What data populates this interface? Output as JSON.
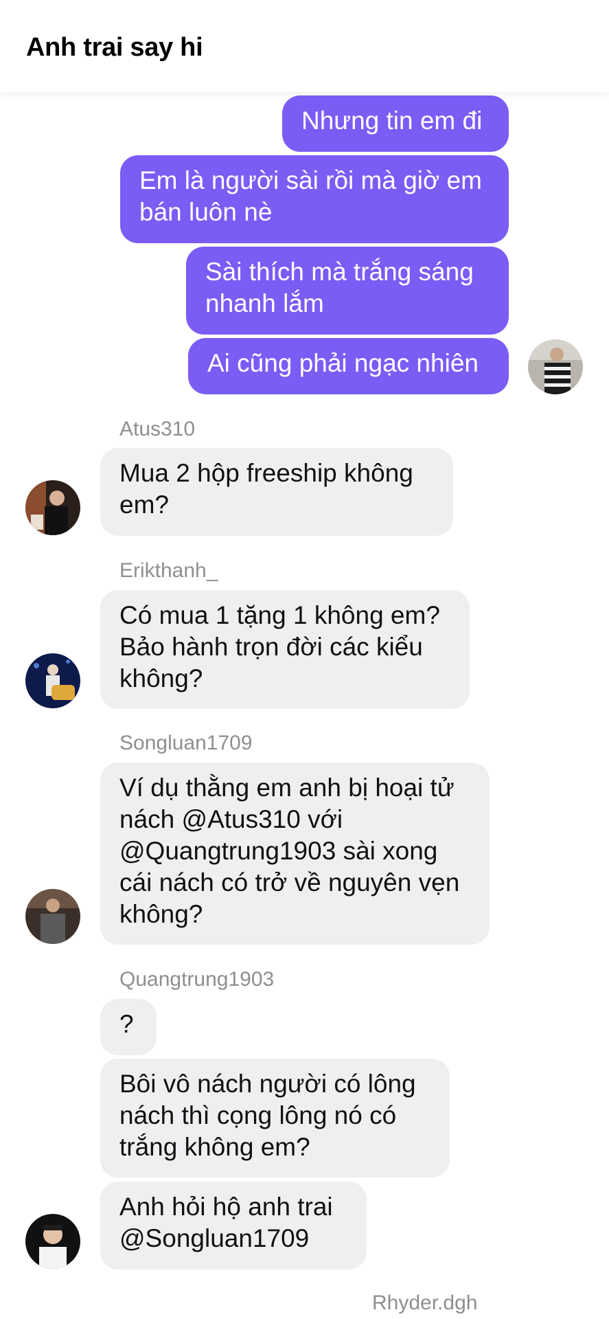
{
  "header": {
    "title": "Anh trai say hi"
  },
  "outgoing": {
    "messages": [
      "Nhưng tin em đi",
      [
        "Em là người sài rồi mà giờ em",
        "bán luôn nè"
      ],
      [
        "Sài thích mà trắng sáng",
        "nhanh lắm"
      ],
      "Ai cũng phải ngạc nhiên"
    ]
  },
  "conversation": [
    {
      "sender": "Atus310",
      "messages": [
        [
          "Mua 2 hộp freeship không",
          "em?"
        ]
      ]
    },
    {
      "sender": "Erikthanh_",
      "messages": [
        [
          "Có mua 1 tặng 1 không em?",
          "Bảo hành trọn đời các kiểu",
          "không?"
        ]
      ]
    },
    {
      "sender": "Songluan1709",
      "messages": [
        [
          "Ví dụ thằng em anh bị hoại tử",
          "nách @Atus310 với",
          "@Quangtrung1903 sài xong",
          "cái nách có trở về nguyên vẹn",
          "không?"
        ]
      ]
    },
    {
      "sender": "Quangtrung1903",
      "messages": [
        "?",
        [
          "Bôi vô nách người có lông",
          "nách thì cọng lông nó có",
          "trắng không em?"
        ],
        [
          "Anh hỏi hộ anh trai",
          "@Songluan1709"
        ]
      ]
    },
    {
      "sender": "Rhyder.dgh"
    }
  ],
  "colors": {
    "outgoing_bubble": "#7b5cf5",
    "incoming_bubble": "#efeff2",
    "sender_label": "#8e8e93"
  }
}
